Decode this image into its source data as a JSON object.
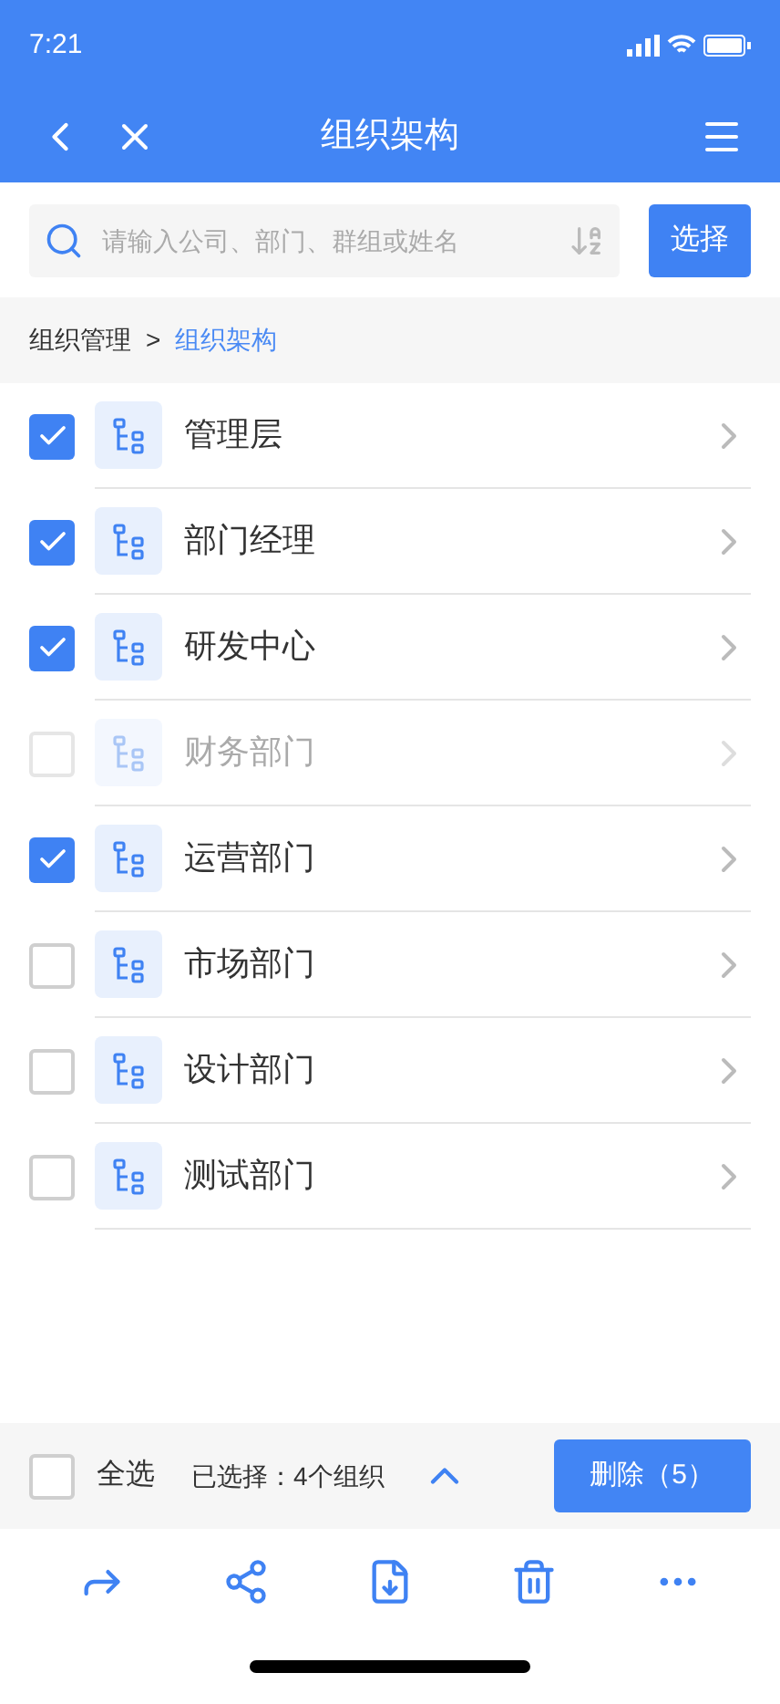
{
  "status_bar": {
    "time": "7:21"
  },
  "nav": {
    "title": "组织架构"
  },
  "search": {
    "placeholder": "请输入公司、部门、群组或姓名",
    "button": "选择"
  },
  "breadcrumb": {
    "parent": "组织管理",
    "separator": ">",
    "current": "组织架构"
  },
  "items": [
    {
      "name": "管理层",
      "checked": true,
      "disabled": false
    },
    {
      "name": "部门经理",
      "checked": true,
      "disabled": false
    },
    {
      "name": "研发中心",
      "checked": true,
      "disabled": false
    },
    {
      "name": "财务部门",
      "checked": false,
      "disabled": true
    },
    {
      "name": "运营部门",
      "checked": true,
      "disabled": false
    },
    {
      "name": "市场部门",
      "checked": false,
      "disabled": false
    },
    {
      "name": "设计部门",
      "checked": false,
      "disabled": false
    },
    {
      "name": "测试部门",
      "checked": false,
      "disabled": false
    }
  ],
  "footer": {
    "select_all": {
      "label": "全选",
      "checked": false
    },
    "selected_text": "已选择：4个组织",
    "delete_button": "删除（5）"
  },
  "toolbar": [
    {
      "kind": "forward"
    },
    {
      "kind": "share"
    },
    {
      "kind": "download"
    },
    {
      "kind": "delete"
    },
    {
      "kind": "more"
    }
  ]
}
